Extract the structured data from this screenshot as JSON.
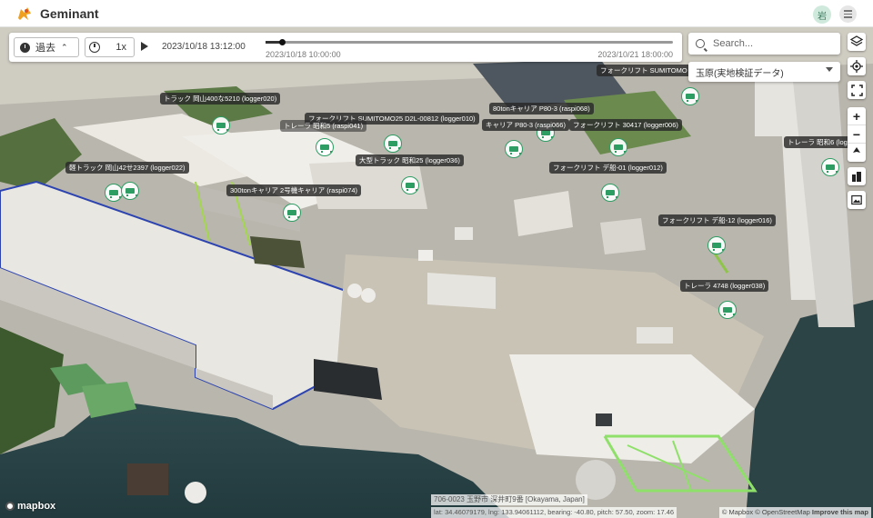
{
  "app": {
    "title": "Geminant",
    "user_initial": "岩"
  },
  "timeline": {
    "period_label": "過去",
    "speed_label": "1x",
    "current_time": "2023/10/18 13:12:00",
    "start_time": "2023/10/18 10:00:00",
    "end_time": "2023/10/21 18:00:00",
    "progress": 0.04
  },
  "search": {
    "placeholder": "Search..."
  },
  "site_select": {
    "value": "玉原(実地検証データ)"
  },
  "map_controls": {
    "layers_icon": "layers-icon",
    "locate_icon": "locate-icon",
    "fullscreen_icon": "fullscreen-icon",
    "zoom_in": "+",
    "zoom_out": "−",
    "compass_icon": "compass-icon",
    "buildings_icon": "buildings-icon",
    "image_icon": "image-icon"
  },
  "vehicles": [
    {
      "label": "トラック 岡山400な5210 (logger020)"
    },
    {
      "label": "フォークリフト SUMITOMO25 D2L-00812 (logger010)"
    },
    {
      "label": "トレーラ 昭和5 (raspi041)"
    },
    {
      "label": "80tonキャリア P80-3 (raspi068)"
    },
    {
      "label": "キャリア P80-3 (raspi066)"
    },
    {
      "label": "フォークリフト 30417 (logger006)"
    },
    {
      "label": "フォークリフト SUMITOMO"
    },
    {
      "label": "軽トラック 岡山42せ2397 (logger022)"
    },
    {
      "label": "大型トラック 昭和25 (logger036)"
    },
    {
      "label": "フォークリフト デ船-01 (logger012)"
    },
    {
      "label": "300tonキャリア 2号機キャリア (raspi074)"
    },
    {
      "label": "トレーラ 昭和6 (logger"
    },
    {
      "label": "フォークリフト デ船-12 (logger016)"
    },
    {
      "label": "トレーラ 4748 (logger038)"
    }
  ],
  "footer": {
    "mapbox_logo": "mapbox",
    "address": "706-0023 玉野市 深井町9番 [Okayama, Japan]",
    "coords": "lat: 34.46079179, lng: 133.94061112, bearing: -40.80, pitch: 57.50, zoom: 17.46",
    "attribution_mapbox": "© Mapbox",
    "attribution_osm": "© OpenStreetMap",
    "attribution_improve": "Improve this map"
  },
  "colors": {
    "accent": "#2e9d64",
    "brand_logo": "#f0a020"
  }
}
